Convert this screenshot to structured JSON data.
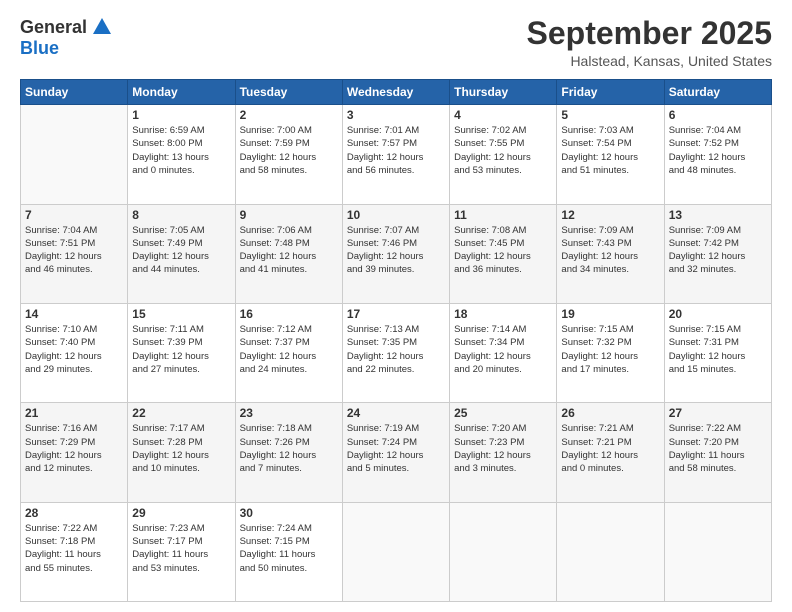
{
  "header": {
    "logo_general": "General",
    "logo_blue": "Blue",
    "month": "September 2025",
    "location": "Halstead, Kansas, United States"
  },
  "weekdays": [
    "Sunday",
    "Monday",
    "Tuesday",
    "Wednesday",
    "Thursday",
    "Friday",
    "Saturday"
  ],
  "weeks": [
    [
      {
        "day": "",
        "info": ""
      },
      {
        "day": "1",
        "info": "Sunrise: 6:59 AM\nSunset: 8:00 PM\nDaylight: 13 hours\nand 0 minutes."
      },
      {
        "day": "2",
        "info": "Sunrise: 7:00 AM\nSunset: 7:59 PM\nDaylight: 12 hours\nand 58 minutes."
      },
      {
        "day": "3",
        "info": "Sunrise: 7:01 AM\nSunset: 7:57 PM\nDaylight: 12 hours\nand 56 minutes."
      },
      {
        "day": "4",
        "info": "Sunrise: 7:02 AM\nSunset: 7:55 PM\nDaylight: 12 hours\nand 53 minutes."
      },
      {
        "day": "5",
        "info": "Sunrise: 7:03 AM\nSunset: 7:54 PM\nDaylight: 12 hours\nand 51 minutes."
      },
      {
        "day": "6",
        "info": "Sunrise: 7:04 AM\nSunset: 7:52 PM\nDaylight: 12 hours\nand 48 minutes."
      }
    ],
    [
      {
        "day": "7",
        "info": "Sunrise: 7:04 AM\nSunset: 7:51 PM\nDaylight: 12 hours\nand 46 minutes."
      },
      {
        "day": "8",
        "info": "Sunrise: 7:05 AM\nSunset: 7:49 PM\nDaylight: 12 hours\nand 44 minutes."
      },
      {
        "day": "9",
        "info": "Sunrise: 7:06 AM\nSunset: 7:48 PM\nDaylight: 12 hours\nand 41 minutes."
      },
      {
        "day": "10",
        "info": "Sunrise: 7:07 AM\nSunset: 7:46 PM\nDaylight: 12 hours\nand 39 minutes."
      },
      {
        "day": "11",
        "info": "Sunrise: 7:08 AM\nSunset: 7:45 PM\nDaylight: 12 hours\nand 36 minutes."
      },
      {
        "day": "12",
        "info": "Sunrise: 7:09 AM\nSunset: 7:43 PM\nDaylight: 12 hours\nand 34 minutes."
      },
      {
        "day": "13",
        "info": "Sunrise: 7:09 AM\nSunset: 7:42 PM\nDaylight: 12 hours\nand 32 minutes."
      }
    ],
    [
      {
        "day": "14",
        "info": "Sunrise: 7:10 AM\nSunset: 7:40 PM\nDaylight: 12 hours\nand 29 minutes."
      },
      {
        "day": "15",
        "info": "Sunrise: 7:11 AM\nSunset: 7:39 PM\nDaylight: 12 hours\nand 27 minutes."
      },
      {
        "day": "16",
        "info": "Sunrise: 7:12 AM\nSunset: 7:37 PM\nDaylight: 12 hours\nand 24 minutes."
      },
      {
        "day": "17",
        "info": "Sunrise: 7:13 AM\nSunset: 7:35 PM\nDaylight: 12 hours\nand 22 minutes."
      },
      {
        "day": "18",
        "info": "Sunrise: 7:14 AM\nSunset: 7:34 PM\nDaylight: 12 hours\nand 20 minutes."
      },
      {
        "day": "19",
        "info": "Sunrise: 7:15 AM\nSunset: 7:32 PM\nDaylight: 12 hours\nand 17 minutes."
      },
      {
        "day": "20",
        "info": "Sunrise: 7:15 AM\nSunset: 7:31 PM\nDaylight: 12 hours\nand 15 minutes."
      }
    ],
    [
      {
        "day": "21",
        "info": "Sunrise: 7:16 AM\nSunset: 7:29 PM\nDaylight: 12 hours\nand 12 minutes."
      },
      {
        "day": "22",
        "info": "Sunrise: 7:17 AM\nSunset: 7:28 PM\nDaylight: 12 hours\nand 10 minutes."
      },
      {
        "day": "23",
        "info": "Sunrise: 7:18 AM\nSunset: 7:26 PM\nDaylight: 12 hours\nand 7 minutes."
      },
      {
        "day": "24",
        "info": "Sunrise: 7:19 AM\nSunset: 7:24 PM\nDaylight: 12 hours\nand 5 minutes."
      },
      {
        "day": "25",
        "info": "Sunrise: 7:20 AM\nSunset: 7:23 PM\nDaylight: 12 hours\nand 3 minutes."
      },
      {
        "day": "26",
        "info": "Sunrise: 7:21 AM\nSunset: 7:21 PM\nDaylight: 12 hours\nand 0 minutes."
      },
      {
        "day": "27",
        "info": "Sunrise: 7:22 AM\nSunset: 7:20 PM\nDaylight: 11 hours\nand 58 minutes."
      }
    ],
    [
      {
        "day": "28",
        "info": "Sunrise: 7:22 AM\nSunset: 7:18 PM\nDaylight: 11 hours\nand 55 minutes."
      },
      {
        "day": "29",
        "info": "Sunrise: 7:23 AM\nSunset: 7:17 PM\nDaylight: 11 hours\nand 53 minutes."
      },
      {
        "day": "30",
        "info": "Sunrise: 7:24 AM\nSunset: 7:15 PM\nDaylight: 11 hours\nand 50 minutes."
      },
      {
        "day": "",
        "info": ""
      },
      {
        "day": "",
        "info": ""
      },
      {
        "day": "",
        "info": ""
      },
      {
        "day": "",
        "info": ""
      }
    ]
  ]
}
